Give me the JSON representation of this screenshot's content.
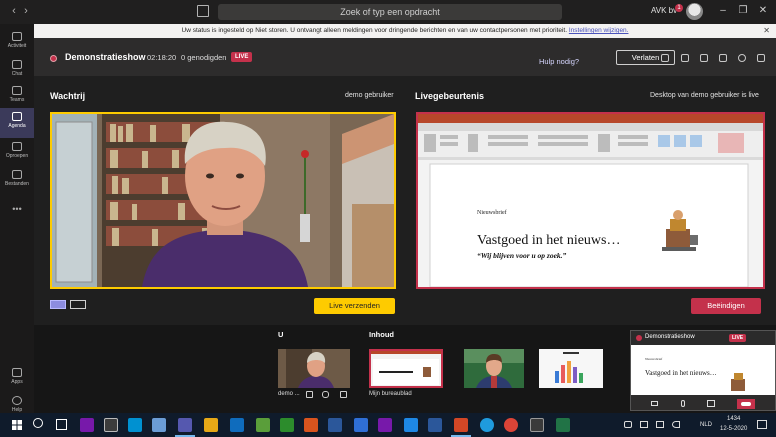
{
  "titlebar": {
    "search_placeholder": "Zoek of typ een opdracht",
    "org_name": "AVK bv",
    "notification_count": "1"
  },
  "notification": {
    "text": "Uw status is ingesteld op Niet storen. U ontvangt alleen meldingen voor dringende berichten en van uw contactpersonen met prioriteit.",
    "link": "Instellingen wijzigen."
  },
  "rail": {
    "items": [
      {
        "label": "Activiteit",
        "icon": "bell-icon"
      },
      {
        "label": "Chat",
        "icon": "chat-icon"
      },
      {
        "label": "Teams",
        "icon": "teams-icon"
      },
      {
        "label": "Agenda",
        "icon": "calendar-icon"
      },
      {
        "label": "Oproepen",
        "icon": "phone-icon"
      },
      {
        "label": "Bestanden",
        "icon": "files-icon"
      }
    ],
    "bottom": [
      {
        "label": "Apps",
        "icon": "apps-icon"
      },
      {
        "label": "Help",
        "icon": "help-icon"
      }
    ]
  },
  "meeting": {
    "title": "Demonstratieshow",
    "elapsed": "02:18:20",
    "guests": "0 genodigden",
    "live_badge": "LIVE",
    "help": "Hulp nodig?",
    "leave": "Verlaten"
  },
  "queue": {
    "title": "Wachtrij",
    "subtitle": "demo gebruiker",
    "send_button": "Live verzenden"
  },
  "live_event": {
    "title": "Livegebeurtenis",
    "subtitle": "Desktop van demo gebruiker is live",
    "end_button": "Beëindigen"
  },
  "slide": {
    "label": "Nieuwsbrief",
    "title": "Vastgoed in het nieuws…",
    "subtitle": "“Wij blijven voor u op zoek.”"
  },
  "strip": {
    "label_left": "U",
    "label_right": "Inhoud",
    "user_caption": "demo ...",
    "desktop_caption": "Mijn bureaublad"
  },
  "preview": {
    "title": "Demonstratieshow",
    "live_badge": "LIVE"
  },
  "taskbar": {
    "time": "1434",
    "date": "12-5-2020",
    "language": "NLD"
  },
  "colors": {
    "accent_yellow": "#fecb00",
    "live_red": "#c4314b",
    "teams_purple": "#6264a7"
  }
}
